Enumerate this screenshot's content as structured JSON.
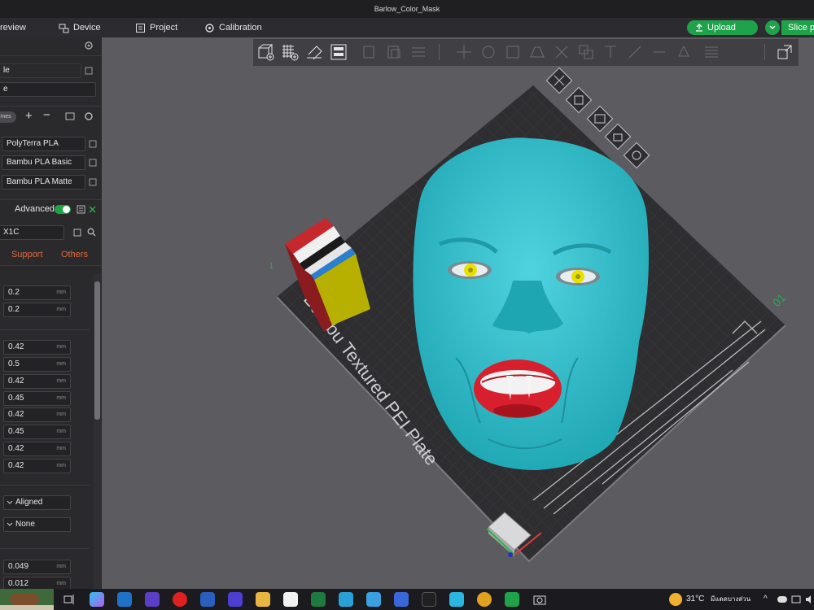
{
  "window": {
    "title": "Barlow_Color_Mask"
  },
  "menu": {
    "preview": "review",
    "device": "Device",
    "project": "Project",
    "calibration": "Calibration",
    "upload": "Upload",
    "slice": "Slice p"
  },
  "sidebar": {
    "plate_field": "le",
    "plate_type_field": "e",
    "filament_chip": "mes",
    "filaments": [
      "PolyTerra PLA",
      "Bambu PLA Basic",
      "Bambu PLA Matte"
    ],
    "advanced_label": "Advanced",
    "advanced_on": true,
    "printer_field": "X1C",
    "tabs": {
      "support": "Support",
      "others": "Others"
    },
    "layer_values": [
      "0.2",
      "0.2"
    ],
    "line_width_values": [
      "0.42",
      "0.5",
      "0.42",
      "0.45",
      "0.42",
      "0.45",
      "0.42",
      "0.42"
    ],
    "seam_value": "Aligned",
    "ironing_value": "None",
    "bottom_values": [
      "0.049",
      "0.012"
    ],
    "unit": "mm"
  },
  "plate": {
    "label": "Bambu Textured PEI Plate",
    "number": "01"
  },
  "taskbar": {
    "weather_temp": "31°C",
    "weather_text": "มีแดดบางส่วน"
  },
  "colors": {
    "accent_green": "#1fa34a",
    "mask_cyan": "#35c3cf",
    "mouth_red": "#d81f2e",
    "eye_yellow": "#e8e000",
    "support_orange": "#e0683a"
  }
}
